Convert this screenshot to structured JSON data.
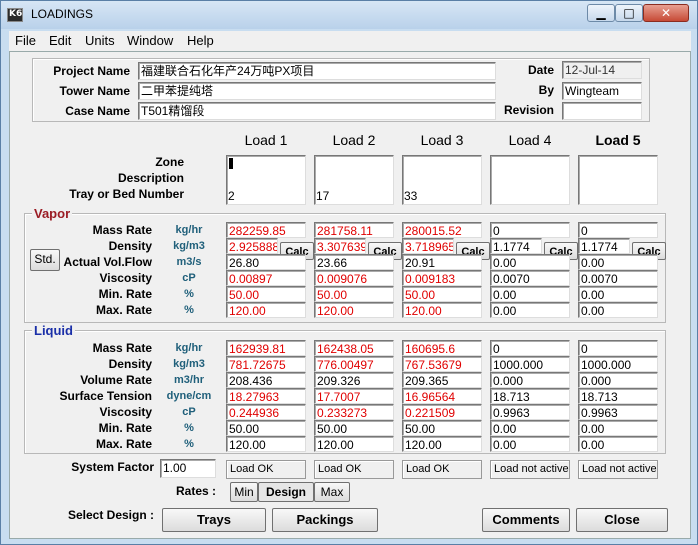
{
  "window": {
    "title": "LOADINGS",
    "icon": "K6"
  },
  "menu": [
    "File",
    "Edit",
    "Units",
    "Window",
    "Help"
  ],
  "header": {
    "project_label": "Project Name",
    "project_value": "福建联合石化年产24万吨PX项目",
    "tower_label": "Tower Name",
    "tower_value": "二甲苯提纯塔",
    "case_label": "Case Name",
    "case_value": "T501精馏段",
    "date_label": "Date",
    "date_value": "12-Jul-14",
    "by_label": "By",
    "by_value": "Wingteam",
    "revision_label": "Revision",
    "revision_value": ""
  },
  "loads": [
    "Load 1",
    "Load 2",
    "Load 3",
    "Load 4",
    "Load 5"
  ],
  "top_labels": {
    "zone": "Zone",
    "description": "Description",
    "tray": "Tray or Bed Number"
  },
  "zone_values": [
    "",
    "",
    "",
    "",
    ""
  ],
  "description_values": [
    "",
    "",
    "",
    "",
    ""
  ],
  "tray_values": [
    "2",
    "17",
    "33",
    "",
    ""
  ],
  "vapor": {
    "title": "Vapor",
    "std_button": "Std.",
    "calc_label": "Calc",
    "rows": [
      {
        "label": "Mass Rate",
        "unit": "kg/hr",
        "values": [
          "282259.85",
          "281758.11",
          "280015.52",
          "0",
          "0"
        ],
        "red": [
          true,
          true,
          true,
          false,
          false
        ]
      },
      {
        "label": "Density",
        "unit": "kg/m3",
        "values": [
          "2.925888",
          "3.307639",
          "3.718965",
          "1.1774",
          "1.1774"
        ],
        "red": [
          true,
          true,
          true,
          false,
          false
        ]
      },
      {
        "label": "Actual Vol.Flow",
        "unit": "m3/s",
        "values": [
          "26.80",
          "23.66",
          "20.91",
          "0.00",
          "0.00"
        ],
        "red": [
          false,
          false,
          false,
          false,
          false
        ]
      },
      {
        "label": "Viscosity",
        "unit": "cP",
        "values": [
          "0.00897",
          "0.009076",
          "0.009183",
          "0.0070",
          "0.0070"
        ],
        "red": [
          true,
          true,
          true,
          false,
          false
        ]
      },
      {
        "label": "Min. Rate",
        "unit": "%",
        "values": [
          "50.00",
          "50.00",
          "50.00",
          "0.00",
          "0.00"
        ],
        "red": [
          true,
          true,
          true,
          false,
          false
        ]
      },
      {
        "label": "Max. Rate",
        "unit": "%",
        "values": [
          "120.00",
          "120.00",
          "120.00",
          "0.00",
          "0.00"
        ],
        "red": [
          true,
          true,
          true,
          false,
          false
        ]
      }
    ]
  },
  "liquid": {
    "title": "Liquid",
    "rows": [
      {
        "label": "Mass Rate",
        "unit": "kg/hr",
        "values": [
          "162939.81",
          "162438.05",
          "160695.6",
          "0",
          "0"
        ],
        "red": [
          true,
          true,
          true,
          false,
          false
        ]
      },
      {
        "label": "Density",
        "unit": "kg/m3",
        "values": [
          "781.72675",
          "776.00497",
          "767.53679",
          "1000.000",
          "1000.000"
        ],
        "red": [
          true,
          true,
          true,
          false,
          false
        ]
      },
      {
        "label": "Volume Rate",
        "unit": "m3/hr",
        "values": [
          "208.436",
          "209.326",
          "209.365",
          "0.000",
          "0.000"
        ],
        "red": [
          false,
          false,
          false,
          false,
          false
        ]
      },
      {
        "label": "Surface Tension",
        "unit": "dyne/cm",
        "values": [
          "18.27963",
          "17.7007",
          "16.96564",
          "18.713",
          "18.713"
        ],
        "red": [
          true,
          true,
          true,
          false,
          false
        ]
      },
      {
        "label": "Viscosity",
        "unit": "cP",
        "values": [
          "0.244936",
          "0.233273",
          "0.221509",
          "0.9963",
          "0.9963"
        ],
        "red": [
          true,
          true,
          true,
          false,
          false
        ]
      },
      {
        "label": "Min. Rate",
        "unit": "%",
        "values": [
          "50.00",
          "50.00",
          "50.00",
          "0.00",
          "0.00"
        ],
        "red": [
          false,
          false,
          false,
          false,
          false
        ]
      },
      {
        "label": "Max. Rate",
        "unit": "%",
        "values": [
          "120.00",
          "120.00",
          "120.00",
          "0.00",
          "0.00"
        ],
        "red": [
          false,
          false,
          false,
          false,
          false
        ]
      }
    ]
  },
  "system_factor": {
    "label": "System Factor",
    "value": "1.00"
  },
  "status": [
    "Load OK",
    "Load OK",
    "Load OK",
    "Load not active",
    "Load not active"
  ],
  "rates": {
    "label": "Rates :",
    "options": [
      "Min",
      "Design",
      "Max"
    ],
    "selected": "Design"
  },
  "bottom": {
    "select_label": "Select Design :",
    "trays": "Trays",
    "packings": "Packings",
    "comments": "Comments",
    "close": "Close"
  }
}
